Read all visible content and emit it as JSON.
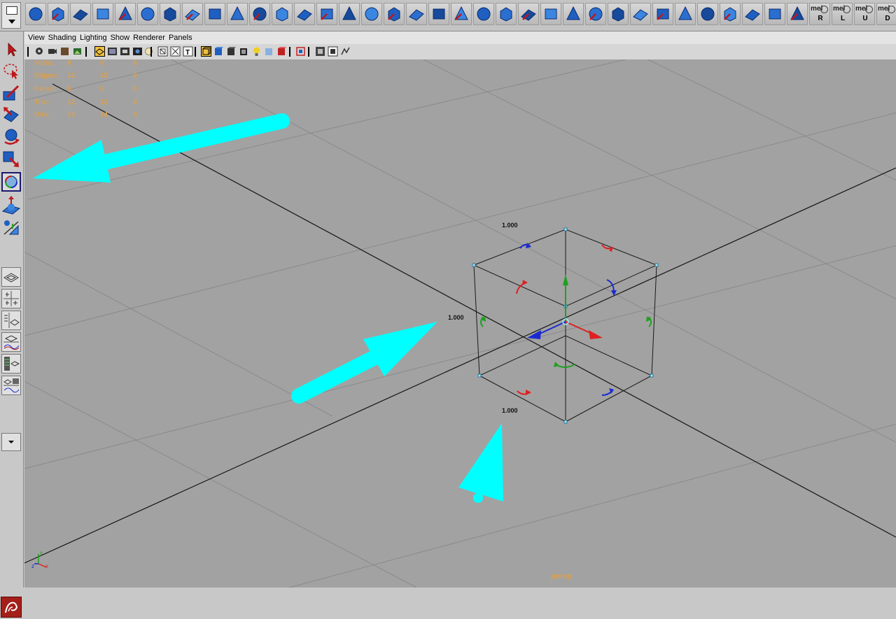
{
  "shelf": {
    "icons": [
      "poly-sphere-icon",
      "poly-cube-icon",
      "poly-cylinder-icon",
      "poly-cone-icon",
      "poly-plane-icon",
      "poly-torus-icon",
      "poly-prism-icon",
      "poly-pipe-icon",
      "poly-helix-icon",
      "poly-soccer-ball-icon",
      "combine-icon",
      "separate-icon",
      "boolean-icon",
      "smooth-icon",
      "cage-icon",
      "extrude-icon",
      "bridge-icon",
      "append-polygon-icon",
      "merge-icon",
      "split-polygon-icon",
      "insert-edge-loop-icon",
      "offset-edge-loop-icon",
      "poke-icon",
      "wedge-icon",
      "duplicate-face-icon",
      "extract-icon",
      "sculpt-icon",
      "soft-select-icon",
      "checker-icon",
      "uv-layout-icon",
      "uv-editor-icon",
      "uv-snapshot-icon",
      "texture-icon",
      "bevel-icon",
      "shape-icon"
    ],
    "mel_buttons": [
      {
        "label": "mel",
        "caption": "R"
      },
      {
        "label": "mel",
        "caption": "L"
      },
      {
        "label": "mel",
        "caption": "U"
      },
      {
        "label": "mel",
        "caption": "D"
      }
    ]
  },
  "panel_menu": {
    "items": [
      "View",
      "Shading",
      "Lighting",
      "Show",
      "Renderer",
      "Panels"
    ]
  },
  "hud": {
    "rows": [
      {
        "label": "Verts:",
        "a": "8",
        "b": "8",
        "c": "0"
      },
      {
        "label": "Edges:",
        "a": "12",
        "b": "12",
        "c": "0"
      },
      {
        "label": "Faces:",
        "a": "6",
        "b": "6",
        "c": "0"
      },
      {
        "label": "Tris:",
        "a": "12",
        "b": "12",
        "c": "0"
      },
      {
        "label": "UVs:",
        "a": "14",
        "b": "14",
        "c": "0"
      }
    ]
  },
  "dimensions": {
    "top": "1.000",
    "left": "1.000",
    "bottom": "1.000"
  },
  "camera": {
    "label": "persp"
  },
  "colors": {
    "viewport_bg": "#a2a2a2",
    "annotation_arrow": "#00ffff",
    "hud_text": "#d9a050",
    "axis_x": "#e02020",
    "axis_y": "#20a020",
    "axis_z": "#1a2ad0"
  }
}
